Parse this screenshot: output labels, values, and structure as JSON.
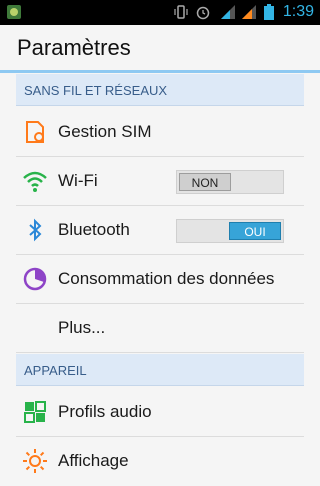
{
  "status_bar": {
    "time": "1:39",
    "icons": [
      "app-icon",
      "vibrate-icon",
      "alarm-icon",
      "signal-1-icon",
      "signal-2-icon",
      "battery-icon"
    ]
  },
  "action_bar": {
    "title": "Paramètres"
  },
  "sections": {
    "wireless": "SANS FIL ET RÉSEAUX",
    "device": "APPAREIL"
  },
  "items": {
    "sim": {
      "label": "Gestion SIM",
      "icon": "sim-card-icon"
    },
    "wifi": {
      "label": "Wi-Fi",
      "icon": "wifi-icon",
      "toggle": "NON",
      "state": "off"
    },
    "bluetooth": {
      "label": "Bluetooth",
      "icon": "bluetooth-icon",
      "toggle": "OUI",
      "state": "on"
    },
    "data": {
      "label": "Consommation des données",
      "icon": "data-usage-icon"
    },
    "more": {
      "label": "Plus..."
    },
    "audio": {
      "label": "Profils audio",
      "icon": "audio-profiles-icon"
    },
    "display": {
      "label": "Affichage",
      "icon": "display-brightness-icon"
    }
  },
  "colors": {
    "accent": "#33b5e5",
    "section_bg": "#dde9f7",
    "section_text": "#385d8a",
    "toggle_on": "#37a4d8"
  }
}
